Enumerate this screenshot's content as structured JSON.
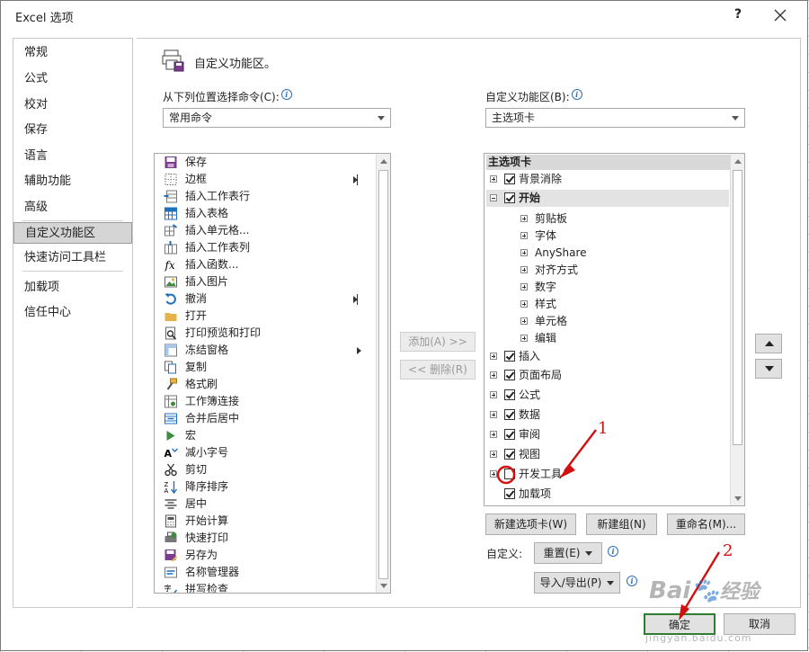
{
  "window": {
    "title": "Excel 选项",
    "help": "?",
    "close": "×"
  },
  "sidebar": {
    "items": [
      {
        "label": "常规"
      },
      {
        "label": "公式"
      },
      {
        "label": "校对"
      },
      {
        "label": "保存"
      },
      {
        "label": "语言"
      },
      {
        "label": "辅助功能"
      },
      {
        "label": "高级"
      },
      {
        "label": "自定义功能区",
        "active": true
      },
      {
        "label": "快速访问工具栏"
      },
      {
        "label": "加载项"
      },
      {
        "label": "信任中心"
      }
    ]
  },
  "main": {
    "section_title": "自定义功能区。",
    "left_label": "从下列位置选择命令(C):",
    "left_combo": "常用命令",
    "right_label": "自定义功能区(B):",
    "right_combo": "主选项卡",
    "commands": [
      {
        "label": "保存",
        "icon": "save-icon"
      },
      {
        "label": "边框",
        "icon": "border-icon",
        "submenu": "bar"
      },
      {
        "label": "插入工作表行",
        "icon": "insert-row-icon"
      },
      {
        "label": "插入表格",
        "icon": "insert-table-icon"
      },
      {
        "label": "插入单元格...",
        "icon": "insert-cells-icon"
      },
      {
        "label": "插入工作表列",
        "icon": "insert-column-icon"
      },
      {
        "label": "插入函数...",
        "icon": "function-icon"
      },
      {
        "label": "插入图片",
        "icon": "picture-icon"
      },
      {
        "label": "撤消",
        "icon": "undo-icon",
        "submenu": "bar"
      },
      {
        "label": "打开",
        "icon": "folder-icon"
      },
      {
        "label": "打印预览和打印",
        "icon": "print-preview-icon"
      },
      {
        "label": "冻结窗格",
        "icon": "freeze-panes-icon",
        "submenu": "arrow"
      },
      {
        "label": "复制",
        "icon": "copy-icon"
      },
      {
        "label": "格式刷",
        "icon": "format-painter-icon"
      },
      {
        "label": "工作簿连接",
        "icon": "connections-icon"
      },
      {
        "label": "合并后居中",
        "icon": "merge-center-icon"
      },
      {
        "label": "宏",
        "icon": "macro-icon"
      },
      {
        "label": "减小字号",
        "icon": "decrease-font-icon"
      },
      {
        "label": "剪切",
        "icon": "cut-icon"
      },
      {
        "label": "降序排序",
        "icon": "sort-desc-icon"
      },
      {
        "label": "居中",
        "icon": "center-align-icon"
      },
      {
        "label": "开始计算",
        "icon": "calculator-icon"
      },
      {
        "label": "快速打印",
        "icon": "quick-print-icon"
      },
      {
        "label": "另存为",
        "icon": "save-as-icon"
      },
      {
        "label": "名称管理器",
        "icon": "name-manager-icon"
      },
      {
        "label": "拼写检查",
        "icon": "spelling-icon"
      }
    ],
    "add_button": "添加(A) >>",
    "remove_button": "<< 删除(R)",
    "tree_header": "主选项卡",
    "tree": [
      {
        "label": "背景消除",
        "level": 0,
        "expander": "plus",
        "checked": true
      },
      {
        "label": "开始",
        "level": 0,
        "expander": "minus",
        "checked": true,
        "selected": true
      },
      {
        "label": "剪贴板",
        "level": 1,
        "expander": "plus"
      },
      {
        "label": "字体",
        "level": 1,
        "expander": "plus"
      },
      {
        "label": "AnyShare",
        "level": 1,
        "expander": "plus"
      },
      {
        "label": "对齐方式",
        "level": 1,
        "expander": "plus"
      },
      {
        "label": "数字",
        "level": 1,
        "expander": "plus"
      },
      {
        "label": "样式",
        "level": 1,
        "expander": "plus"
      },
      {
        "label": "单元格",
        "level": 1,
        "expander": "plus"
      },
      {
        "label": "编辑",
        "level": 1,
        "expander": "plus"
      },
      {
        "label": "插入",
        "level": 0,
        "expander": "plus",
        "checked": true
      },
      {
        "label": "页面布局",
        "level": 0,
        "expander": "plus",
        "checked": true
      },
      {
        "label": "公式",
        "level": 0,
        "expander": "plus",
        "checked": true
      },
      {
        "label": "数据",
        "level": 0,
        "expander": "plus",
        "checked": true
      },
      {
        "label": "审阅",
        "level": 0,
        "expander": "plus",
        "checked": true
      },
      {
        "label": "视图",
        "level": 0,
        "expander": "plus",
        "checked": true
      },
      {
        "label": "开发工具",
        "level": 0,
        "expander": "plus",
        "checked": false
      },
      {
        "label": "加载项",
        "level": 0,
        "expander": "none",
        "checked": true
      }
    ],
    "new_tab_button": "新建选项卡(W)",
    "new_group_button": "新建组(N)",
    "rename_button": "重命名(M)...",
    "customize_label": "自定义:",
    "reset_button": "重置(E)",
    "import_export_button": "导入/导出(P)",
    "ok_button": "确定",
    "cancel_button": "取消"
  },
  "annotations": {
    "step1": "1",
    "step2": "2",
    "color": "#d31010"
  },
  "watermark": {
    "brand": "Bai",
    "brand_cn": "经验",
    "url": "jingyan.baidu.com"
  }
}
